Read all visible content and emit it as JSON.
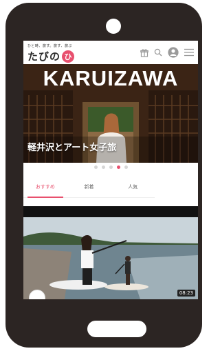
{
  "header": {
    "tagline": "ひと時、旅す。旅す、旅ぶ",
    "brand": "たびの",
    "brand_mark": "ひ",
    "icons": [
      "gift-icon",
      "search-icon",
      "user-icon",
      "menu-icon"
    ]
  },
  "hero": {
    "title": "KARUIZAWA",
    "caption": "軽井沢とアート女子旅",
    "slide_count": 5,
    "active_slide": 4
  },
  "tabs": [
    {
      "label": "おすすめ",
      "active": true
    },
    {
      "label": "新着",
      "active": false
    },
    {
      "label": "人気",
      "active": false
    }
  ],
  "video": {
    "duration": "08:23"
  },
  "colors": {
    "accent": "#e8506e",
    "phone": "#2c2523"
  }
}
